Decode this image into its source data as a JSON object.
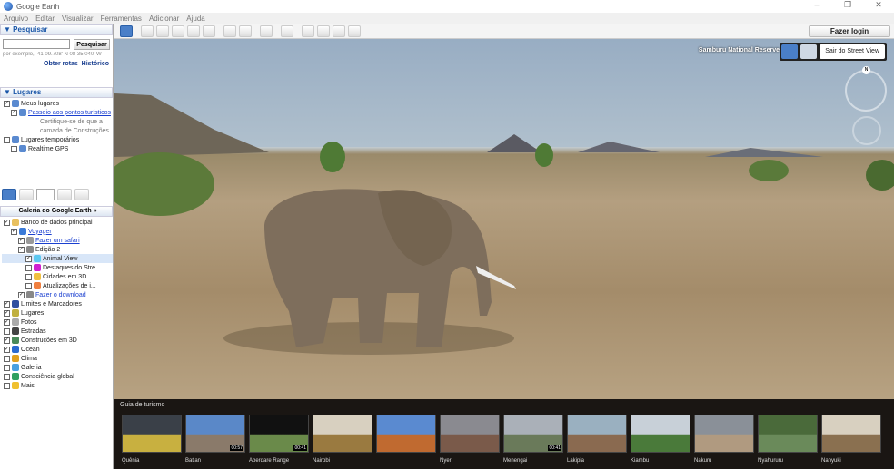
{
  "app": {
    "title": "Google Earth",
    "window_controls": [
      "–",
      "❐",
      "✕"
    ]
  },
  "menu": [
    "Arquivo",
    "Editar",
    "Visualizar",
    "Ferramentas",
    "Adicionar",
    "Ajuda"
  ],
  "login_button": "Fazer login",
  "search": {
    "header": "▼ Pesquisar",
    "input_value": "",
    "button": "Pesquisar",
    "example": "por exemplo,: 41 09.708' N 08 35.040' W",
    "routes": "Obter rotas",
    "history": "Histórico"
  },
  "places": {
    "header": "▼ Lugares",
    "items": [
      {
        "label": "Meus lugares",
        "checked": true,
        "level": 0
      },
      {
        "label": "Passeio aos pontos turísticos",
        "checked": true,
        "level": 1,
        "link": true
      },
      {
        "label": "Certifique-se de que a",
        "level": 2,
        "note": true
      },
      {
        "label": "camada de Construções",
        "level": 2,
        "note": true
      },
      {
        "label": "Lugares temporários",
        "checked": false,
        "level": 0
      },
      {
        "label": "Realtime GPS",
        "checked": false,
        "level": 1
      }
    ]
  },
  "layers": {
    "header": "Galeria do Google Earth »",
    "items": [
      {
        "label": "Banco de dados principal",
        "checked": true,
        "level": 0,
        "color": "#e8c060"
      },
      {
        "label": "Voyager",
        "checked": true,
        "level": 1,
        "link": true,
        "color": "#3a7ad8"
      },
      {
        "label": "Fazer um safari",
        "checked": true,
        "level": 2,
        "link": true,
        "color": "#999"
      },
      {
        "label": "Edição 2",
        "checked": true,
        "level": 2,
        "color": "#888"
      },
      {
        "label": "Animal View",
        "checked": true,
        "level": 3,
        "selected": true,
        "color": "#5cc8f0"
      },
      {
        "label": "Destaques do Stre...",
        "checked": false,
        "level": 3,
        "color": "#d020d0"
      },
      {
        "label": "Cidades em 3D",
        "checked": false,
        "level": 3,
        "color": "#f0c040"
      },
      {
        "label": "Atualizações de i...",
        "checked": false,
        "level": 3,
        "color": "#f08040"
      },
      {
        "label": "Fazer o download",
        "checked": true,
        "level": 2,
        "link": true,
        "color": "#888"
      },
      {
        "label": "Limites e Marcadores",
        "checked": true,
        "level": 0,
        "color": "#3050a0"
      },
      {
        "label": "Lugares",
        "checked": true,
        "level": 0,
        "color": "#c0b040"
      },
      {
        "label": "Fotos",
        "checked": true,
        "level": 0,
        "color": "#aaa"
      },
      {
        "label": "Estradas",
        "checked": false,
        "level": 0,
        "color": "#444"
      },
      {
        "label": "Construções em 3D",
        "checked": true,
        "level": 0,
        "color": "#4a8a5a"
      },
      {
        "label": "Ocean",
        "checked": true,
        "level": 0,
        "color": "#2a6ad0"
      },
      {
        "label": "Clima",
        "checked": false,
        "level": 0,
        "color": "#e0a020"
      },
      {
        "label": "Galeria",
        "checked": false,
        "level": 0,
        "color": "#4aa0e0"
      },
      {
        "label": "Consciência global",
        "checked": false,
        "level": 0,
        "color": "#30a060"
      },
      {
        "label": "Mais",
        "checked": false,
        "level": 0,
        "color": "#f0c030"
      }
    ]
  },
  "map": {
    "location_label": "Samburu National Reserve",
    "exit_button": "Sair do Street View",
    "compass": "N"
  },
  "tour": {
    "header": "Guia de turismo",
    "items": [
      {
        "label": "Quênia",
        "duration": "",
        "c1": "#3a4048",
        "c2": "#c8b040"
      },
      {
        "label": "Batian",
        "duration": "00:57",
        "c1": "#5a88c8",
        "c2": "#8a7a6a"
      },
      {
        "label": "Aberdare Range",
        "duration": "00:41",
        "c1": "#111",
        "c2": "#6a8a4a"
      },
      {
        "label": "Nairobi",
        "duration": "",
        "c1": "#d8d0c0",
        "c2": "#9a7a40"
      },
      {
        "label": "",
        "duration": "",
        "c1": "#5a8ad0",
        "c2": "#c06a30"
      },
      {
        "label": "Nyeri",
        "duration": "",
        "c1": "#8a8a90",
        "c2": "#7a5a4a"
      },
      {
        "label": "Menengai",
        "duration": "00:41",
        "c1": "#aab0b8",
        "c2": "#6a7a5a"
      },
      {
        "label": "Lakipia",
        "duration": "",
        "c1": "#9ab0c0",
        "c2": "#8a6a50"
      },
      {
        "label": "Kiambu",
        "duration": "",
        "c1": "#c8d0d8",
        "c2": "#4a7a3a"
      },
      {
        "label": "Nakuru",
        "duration": "",
        "c1": "#8a9098",
        "c2": "#b09a80"
      },
      {
        "label": "Nyahururu",
        "duration": "",
        "c1": "#4a6a3a",
        "c2": "#6a8a5a"
      },
      {
        "label": "Nanyuki",
        "duration": "",
        "c1": "#d8d0c0",
        "c2": "#8a7050"
      }
    ]
  }
}
